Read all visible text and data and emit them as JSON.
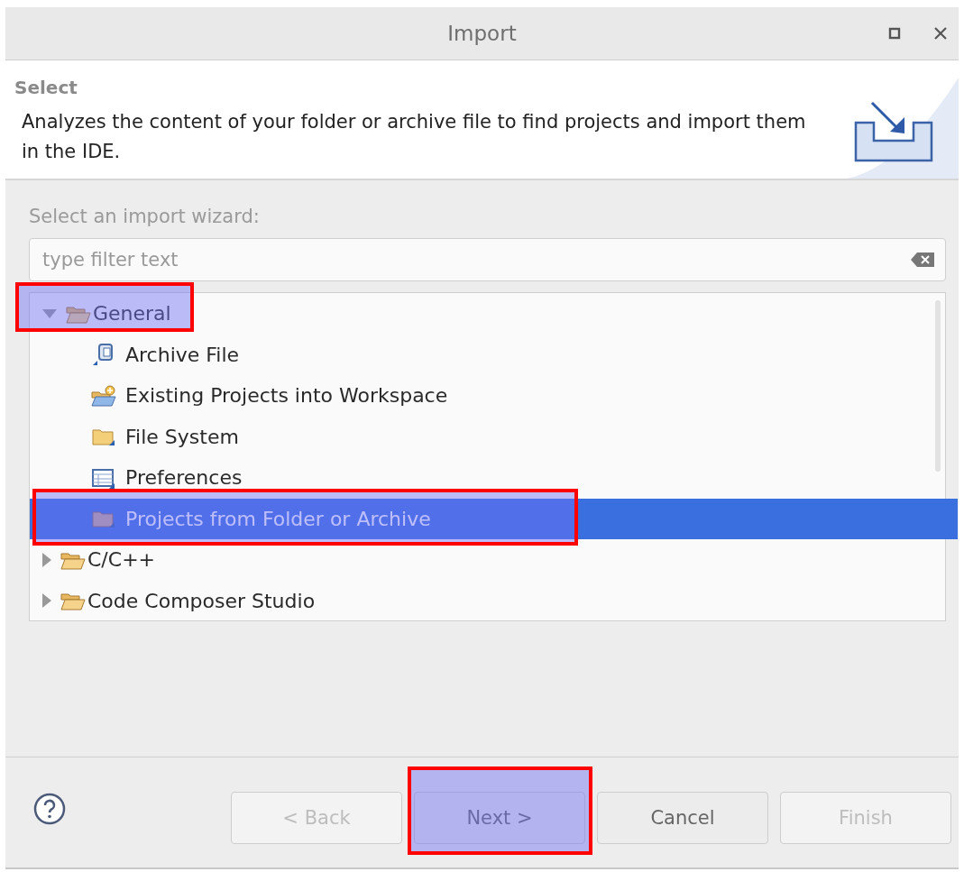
{
  "window": {
    "title": "Import"
  },
  "header": {
    "title": "Select",
    "description": "Analyzes the content of your folder or archive file to find projects and import them in the IDE."
  },
  "wizard_label": "Select an import wizard:",
  "filter": {
    "placeholder": "type filter text"
  },
  "tree": [
    {
      "label": "General",
      "expanded": true,
      "selected": false,
      "highlighted": true,
      "children": [
        {
          "label": "Archive File",
          "selected": false,
          "highlighted": false
        },
        {
          "label": "Existing Projects into Workspace",
          "selected": false,
          "highlighted": false
        },
        {
          "label": "File System",
          "selected": false,
          "highlighted": false
        },
        {
          "label": "Preferences",
          "selected": false,
          "highlighted": false
        },
        {
          "label": "Projects from Folder or Archive",
          "selected": true,
          "highlighted": true
        }
      ]
    },
    {
      "label": "C/C++",
      "expanded": false,
      "selected": false,
      "highlighted": false
    },
    {
      "label": "Code Composer Studio",
      "expanded": false,
      "selected": false,
      "highlighted": false
    }
  ],
  "buttons": [
    {
      "label": "< Back",
      "disabled": true,
      "highlighted": false
    },
    {
      "label": "Next >",
      "disabled": false,
      "highlighted": true
    },
    {
      "label": "Cancel",
      "disabled": false,
      "highlighted": false
    },
    {
      "label": "Finish",
      "disabled": true,
      "highlighted": false
    }
  ]
}
